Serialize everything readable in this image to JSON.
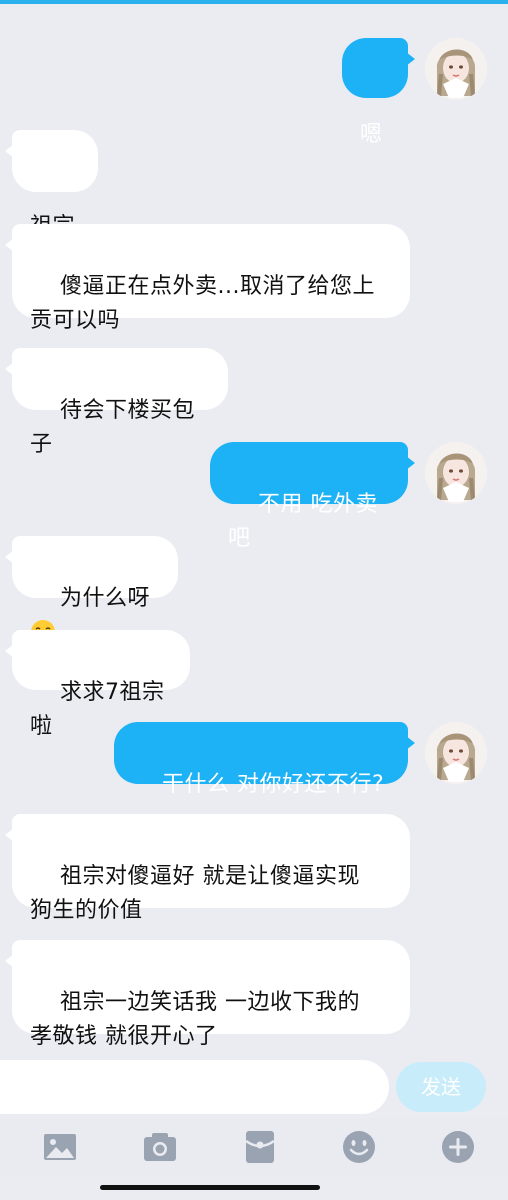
{
  "messages": [
    {
      "side": "out",
      "text": "嗯"
    },
    {
      "side": "in",
      "text": "祖宗"
    },
    {
      "side": "in",
      "text": "傻逼正在点外卖...取消了给您上\n贡可以吗"
    },
    {
      "side": "in",
      "text": "待会下楼买包子"
    },
    {
      "side": "out",
      "text": "不用 吃外卖吧"
    },
    {
      "side": "in",
      "text": "为什么呀",
      "emoji": "crying-face"
    },
    {
      "side": "in",
      "text": "求求7祖宗啦"
    },
    {
      "side": "out",
      "text": "干什么 对你好还不行?"
    },
    {
      "side": "in",
      "text": "祖宗对傻逼好 就是让傻逼实现\n狗生的价值"
    },
    {
      "side": "in",
      "text": "祖宗一边笑话我 一边收下我的\n孝敬钱 就很开心了"
    }
  ],
  "input": {
    "placeholder": "",
    "send_label": "发送"
  },
  "toolbar": {
    "icons": [
      "image-icon",
      "camera-icon",
      "red-packet-icon",
      "emoji-icon",
      "plus-icon"
    ]
  },
  "colors": {
    "background": "#eaecf2",
    "outgoing_bubble": "#1db1f5",
    "incoming_bubble": "#ffffff",
    "send_button_disabled": "#c9ecfb",
    "toolbar_icon": "#9aa3b2"
  }
}
